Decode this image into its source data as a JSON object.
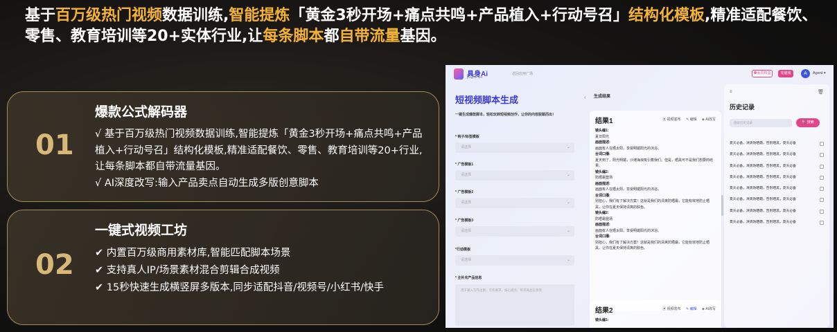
{
  "headline": {
    "p1": "基于",
    "h1": "百万级热门视频",
    "p2": "数据训练,",
    "h2": "智能提炼",
    "p3": "「黄金3秒开场+痛点共鸣+产品植入+行动号召」",
    "h3": "结构化模板",
    "p4": ",精准适配餐饮、零售、教育培训等20+实体行业,让",
    "h4": "每条脚本",
    "p5": "都",
    "h5": "自带流量",
    "p6": "基因。"
  },
  "cards": [
    {
      "num": "01",
      "title": "爆款公式解码器",
      "lines": [
        "√ 基于百万级热门视频数据训练,智能提炼「黄金3秒开场+痛点共鸣+产品植入+行动号召」结构化模板,精准适配餐饮、零售、教育培训等20+行业,让每条脚本都自带流量基因。",
        "√ AI深度改写:输入产品卖点自动生成多版创意脚本"
      ]
    },
    {
      "num": "02",
      "title": "一键式视频工坊",
      "lines": [
        "✔ 内置百万级商用素材库,智能匹配脚本场景",
        "✔ 支持真人IP/场景素材混合剪辑合成视频",
        "✔ 15秒快速生成横竖屏多版本,同步适配抖音/视频号/小红书/快手"
      ]
    }
  ],
  "app": {
    "logo": "具身Ai",
    "logo_sub": "jsagent.net",
    "crumb": "· 返回应用广场",
    "btn1": "✿会员权益",
    "btn2": "充值钱",
    "avatar": "A",
    "agent": "Agent ▾",
    "left": {
      "title": "短视频脚本生成",
      "desc": "一键生成爆款脚本，轻松玩转短视频创作，让你的内容脱颖而出！",
      "fields": [
        {
          "label": "* 钩子/标签模板",
          "placeholder": "请选择"
        },
        {
          "label": "* 广告模板1",
          "placeholder": "请选择"
        },
        {
          "label": "* 广告模板2",
          "placeholder": "请选择"
        },
        {
          "label": "* 广告模板3",
          "placeholder": "请选择"
        },
        {
          "label": "*行动模板",
          "placeholder": "请选择"
        }
      ],
      "area_label": "* 主补充产品信息",
      "area_placeholder": "用于输入写作主题、写作要求、核心观点、带货商品信息等"
    },
    "mid": {
      "header": "生成结果",
      "r1": {
        "title": "结果1",
        "act1": "▣ 视频发布",
        "act2": "✎ 编辑",
        "act3": "◈ AI改写",
        "lines": [
          {
            "t": "镜头编1:",
            "b": true
          },
          {
            "t": "夏日阳光",
            "b": false
          },
          {
            "t": "画面描述:",
            "b": true
          },
          {
            "t": "画面有人在晒太阳，享受明媚阳光的沐浴。",
            "b": false
          },
          {
            "t": "台词口播:",
            "b": true
          },
          {
            "t": "夏天到了，阳光明媚，沙滩海浪吸引着我们。但是，晒黑可不是我们想要的结果。",
            "b": false
          },
          {
            "t": "镜头编2:",
            "b": true
          },
          {
            "t": "防晒霜登场",
            "b": false
          },
          {
            "t": "画面描述:",
            "b": true
          },
          {
            "t": "画面有人在晒太阳，享受明媚阳光的沐浴。",
            "b": false
          },
          {
            "t": "台词口播:",
            "b": true
          },
          {
            "t": "别担心，我们有了解决方案！这就是我们的清爽防晒霜，它能有效地防止晒黑，让你在夏天保持清爽的肤色。",
            "b": false
          },
          {
            "t": "镜头编2:",
            "b": true
          },
          {
            "t": "防晒霜登场",
            "b": false
          },
          {
            "t": "画面描述:",
            "b": true
          },
          {
            "t": "画面有人在晒太阳，享受明媚阳光的沐浴。",
            "b": false
          },
          {
            "t": "台词口播:",
            "b": true
          },
          {
            "t": "别担心，我们有了解决方案！这就是我们的清爽防晒霜，它能有效地防止晒黑，让你在夏天保持清爽的肤色。",
            "b": false
          }
        ]
      },
      "r2": {
        "title": "结果2",
        "act1": "▣ 视频发布",
        "act2": "✎ 编辑",
        "act3": "◈ AI改写",
        "line1": "镜头编1:"
      }
    },
    "right": {
      "title": "历史记录",
      "search_placeholder": "搜索历史记录",
      "search_btn": "🔍 搜索",
      "items": [
        "夏天必备，清爽防晒霜，告别晒黑，夏天必备",
        "夏天必备，清爽防晒霜，告别晒黑，夏天必备",
        "夏天必备，清爽防晒霜，告别晒黑，夏天必备",
        "夏天必备，清爽防晒霜，告别晒黑，夏天必备",
        "夏天必备，清爽防晒霜，告别晒黑，夏天必备",
        "夏天必备，清爽防晒霜，告别晒黑，夏天必备",
        "夏天必备，清爽防晒霜，告别晒黑，夏天必备",
        "夏天必备，清爽防晒霜，告别晒黑，夏天必备"
      ]
    }
  }
}
